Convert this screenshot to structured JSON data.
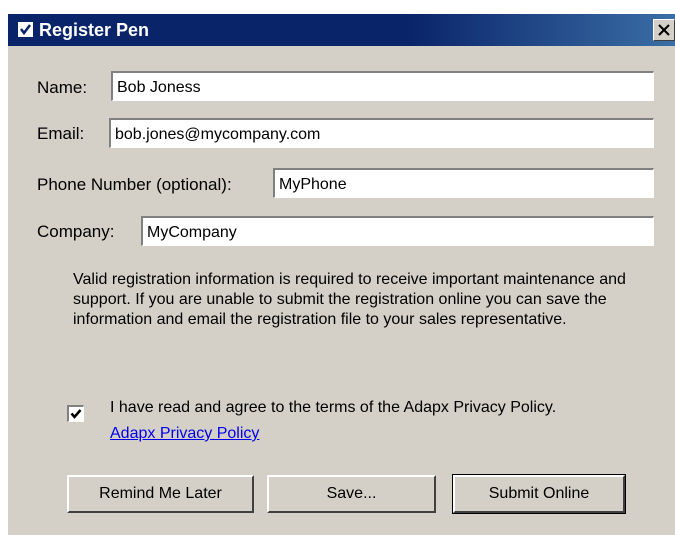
{
  "window": {
    "title": "Register Pen",
    "close_glyph": "close-icon"
  },
  "form": {
    "name_label": "Name:",
    "name_value": "Bob Joness",
    "email_label": "Email:",
    "email_value": "bob.jones@mycompany.com",
    "phone_label": "Phone Number (optional):",
    "phone_value": "MyPhone",
    "company_label": "Company:",
    "company_value": "MyCompany"
  },
  "info": {
    "text": "Valid registration information is required to receive important maintenance and support.  If you are unable to submit the registration online you can save the information and email the registration file to your sales representative."
  },
  "agreement": {
    "checked": true,
    "text": "I have read and agree to the terms of the Adapx Privacy Policy.",
    "link_text": "Adapx Privacy Policy"
  },
  "buttons": {
    "remind_label": "Remind Me Later",
    "save_label": "Save...",
    "submit_label": "Submit Online"
  },
  "colors": {
    "title_bar": "#0a246a",
    "dialog_bg": "#d4d0c8",
    "link": "#0000ee"
  }
}
